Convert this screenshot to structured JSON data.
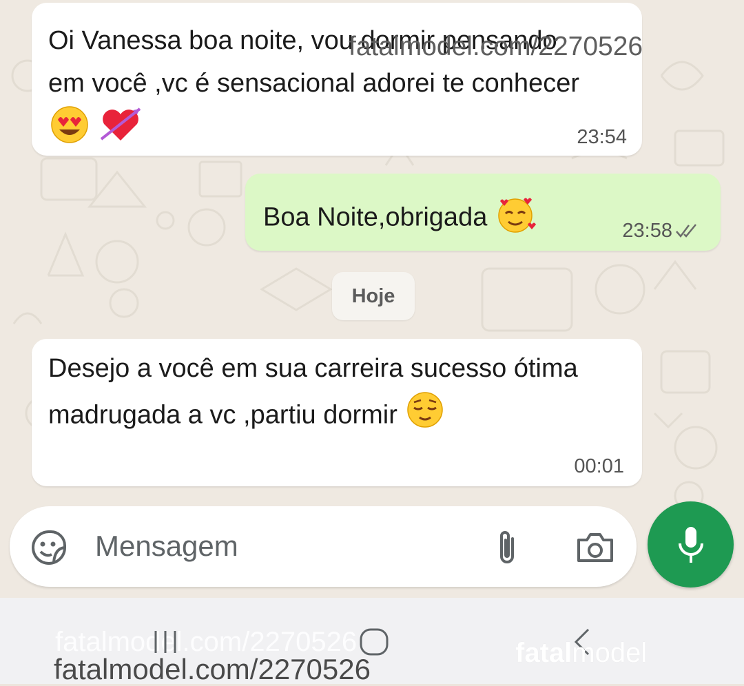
{
  "messages": [
    {
      "direction": "incoming",
      "text": "Oi Vanessa boa noite, vou dormir pensando em você ,vc é sensacional adorei te conhecer",
      "time": "23:54",
      "emojis": [
        "heart-eyes-emoji",
        "heart-with-arrow-emoji"
      ]
    },
    {
      "direction": "outgoing",
      "text": "Boa Noite,obrigada",
      "time": "23:58",
      "status": "read",
      "emojis": [
        "smiling-face-with-hearts-emoji"
      ]
    },
    {
      "direction": "incoming",
      "text": "Desejo a você em sua carreira sucesso ótima madrugada a vc ,partiu dormir",
      "time": "00:01",
      "emojis": [
        "relieved-face-emoji"
      ]
    }
  ],
  "date_separator": "Hoje",
  "composer": {
    "placeholder": "Mensagem"
  },
  "icons": {
    "sticker": "sticker-icon",
    "attach": "paperclip-icon",
    "camera": "camera-icon",
    "mic": "microphone-icon",
    "read_receipt": "double-check-icon"
  },
  "watermarks": {
    "top": "fatalmodel.com/2270526",
    "bottom": "fatalmodel.com/2270526",
    "faint": "fatalmodel.com/2270526",
    "brand_bold": "fatal",
    "brand_rest": "model"
  },
  "colors": {
    "outgoing_bubble": "#dcf8c6",
    "incoming_bubble": "#ffffff",
    "mic_button": "#1e9a52",
    "chat_background": "#efe9e1"
  }
}
